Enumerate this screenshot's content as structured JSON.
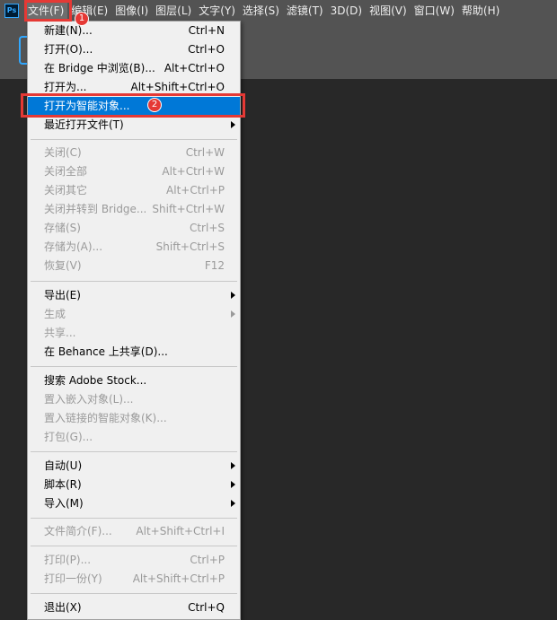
{
  "app": {
    "logo_text": "Ps",
    "accent_color": "#31a8ff"
  },
  "menubar": {
    "items": [
      {
        "label": "文件(F)",
        "active": true
      },
      {
        "label": "编辑(E)"
      },
      {
        "label": "图像(I)"
      },
      {
        "label": "图层(L)"
      },
      {
        "label": "文字(Y)"
      },
      {
        "label": "选择(S)"
      },
      {
        "label": "滤镜(T)"
      },
      {
        "label": "3D(D)"
      },
      {
        "label": "视图(V)"
      },
      {
        "label": "窗口(W)"
      },
      {
        "label": "帮助(H)"
      }
    ]
  },
  "file_menu": {
    "items": [
      {
        "label": "新建(N)...",
        "shortcut": "Ctrl+N",
        "enabled": true
      },
      {
        "label": "打开(O)...",
        "shortcut": "Ctrl+O",
        "enabled": true
      },
      {
        "label": "在 Bridge 中浏览(B)...",
        "shortcut": "Alt+Ctrl+O",
        "enabled": true
      },
      {
        "label": "打开为...",
        "shortcut": "Alt+Shift+Ctrl+O",
        "enabled": true
      },
      {
        "label": "打开为智能对象...",
        "shortcut": "",
        "enabled": true,
        "highlighted": true
      },
      {
        "label": "最近打开文件(T)",
        "shortcut": "",
        "enabled": true,
        "submenu": true
      },
      {
        "label": "关闭(C)",
        "shortcut": "Ctrl+W",
        "enabled": false
      },
      {
        "label": "关闭全部",
        "shortcut": "Alt+Ctrl+W",
        "enabled": false
      },
      {
        "label": "关闭其它",
        "shortcut": "Alt+Ctrl+P",
        "enabled": false
      },
      {
        "label": "关闭并转到 Bridge...",
        "shortcut": "Shift+Ctrl+W",
        "enabled": false
      },
      {
        "label": "存储(S)",
        "shortcut": "Ctrl+S",
        "enabled": false
      },
      {
        "label": "存储为(A)...",
        "shortcut": "Shift+Ctrl+S",
        "enabled": false
      },
      {
        "label": "恢复(V)",
        "shortcut": "F12",
        "enabled": false
      },
      {
        "label": "导出(E)",
        "shortcut": "",
        "enabled": true,
        "submenu": true
      },
      {
        "label": "生成",
        "shortcut": "",
        "enabled": false,
        "submenu": true
      },
      {
        "label": "共享...",
        "shortcut": "",
        "enabled": false
      },
      {
        "label": "在 Behance 上共享(D)...",
        "shortcut": "",
        "enabled": true
      },
      {
        "label": "搜索 Adobe Stock...",
        "shortcut": "",
        "enabled": true
      },
      {
        "label": "置入嵌入对象(L)...",
        "shortcut": "",
        "enabled": false
      },
      {
        "label": "置入链接的智能对象(K)...",
        "shortcut": "",
        "enabled": false
      },
      {
        "label": "打包(G)...",
        "shortcut": "",
        "enabled": false
      },
      {
        "label": "自动(U)",
        "shortcut": "",
        "enabled": true,
        "submenu": true
      },
      {
        "label": "脚本(R)",
        "shortcut": "",
        "enabled": true,
        "submenu": true
      },
      {
        "label": "导入(M)",
        "shortcut": "",
        "enabled": true,
        "submenu": true
      },
      {
        "label": "文件简介(F)...",
        "shortcut": "Alt+Shift+Ctrl+I",
        "enabled": false
      },
      {
        "label": "打印(P)...",
        "shortcut": "Ctrl+P",
        "enabled": false
      },
      {
        "label": "打印一份(Y)",
        "shortcut": "Alt+Shift+Ctrl+P",
        "enabled": false
      },
      {
        "label": "退出(X)",
        "shortcut": "Ctrl+Q",
        "enabled": true
      }
    ]
  },
  "annotations": {
    "step1": "1",
    "step2": "2",
    "color": "#e53935"
  }
}
